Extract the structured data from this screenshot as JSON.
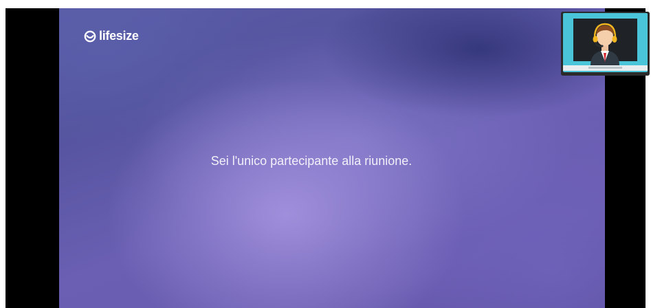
{
  "app": {
    "brand_name": "lifesize",
    "brand_icon": "lifesize-smile-icon"
  },
  "meeting": {
    "status_message": "Sei l'unico partecipante alla riunione."
  },
  "self_view": {
    "icon": "support-agent-headset-icon"
  },
  "colors": {
    "stage_base": "#5a5ca8",
    "stage_highlight": "#a896e1",
    "letterbox": "#000000",
    "self_view_bg": "#49c4d8",
    "self_view_monitor": "#1f1f1f"
  }
}
